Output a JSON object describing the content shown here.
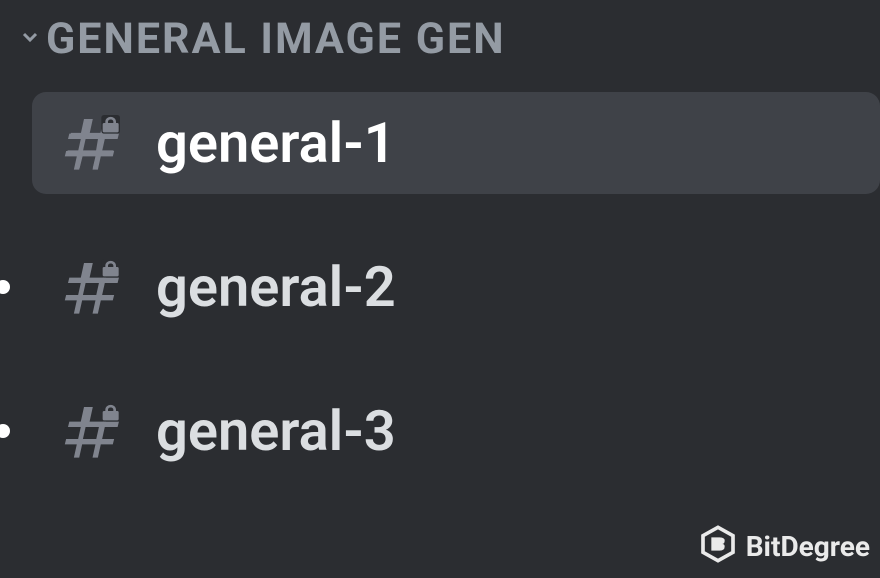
{
  "category": {
    "name": "GENERAL IMAGE GEN"
  },
  "channels": [
    {
      "name": "general-1",
      "selected": true
    },
    {
      "name": "general-2",
      "selected": false
    },
    {
      "name": "general-3",
      "selected": false
    }
  ],
  "watermark": {
    "text": "BitDegree"
  }
}
